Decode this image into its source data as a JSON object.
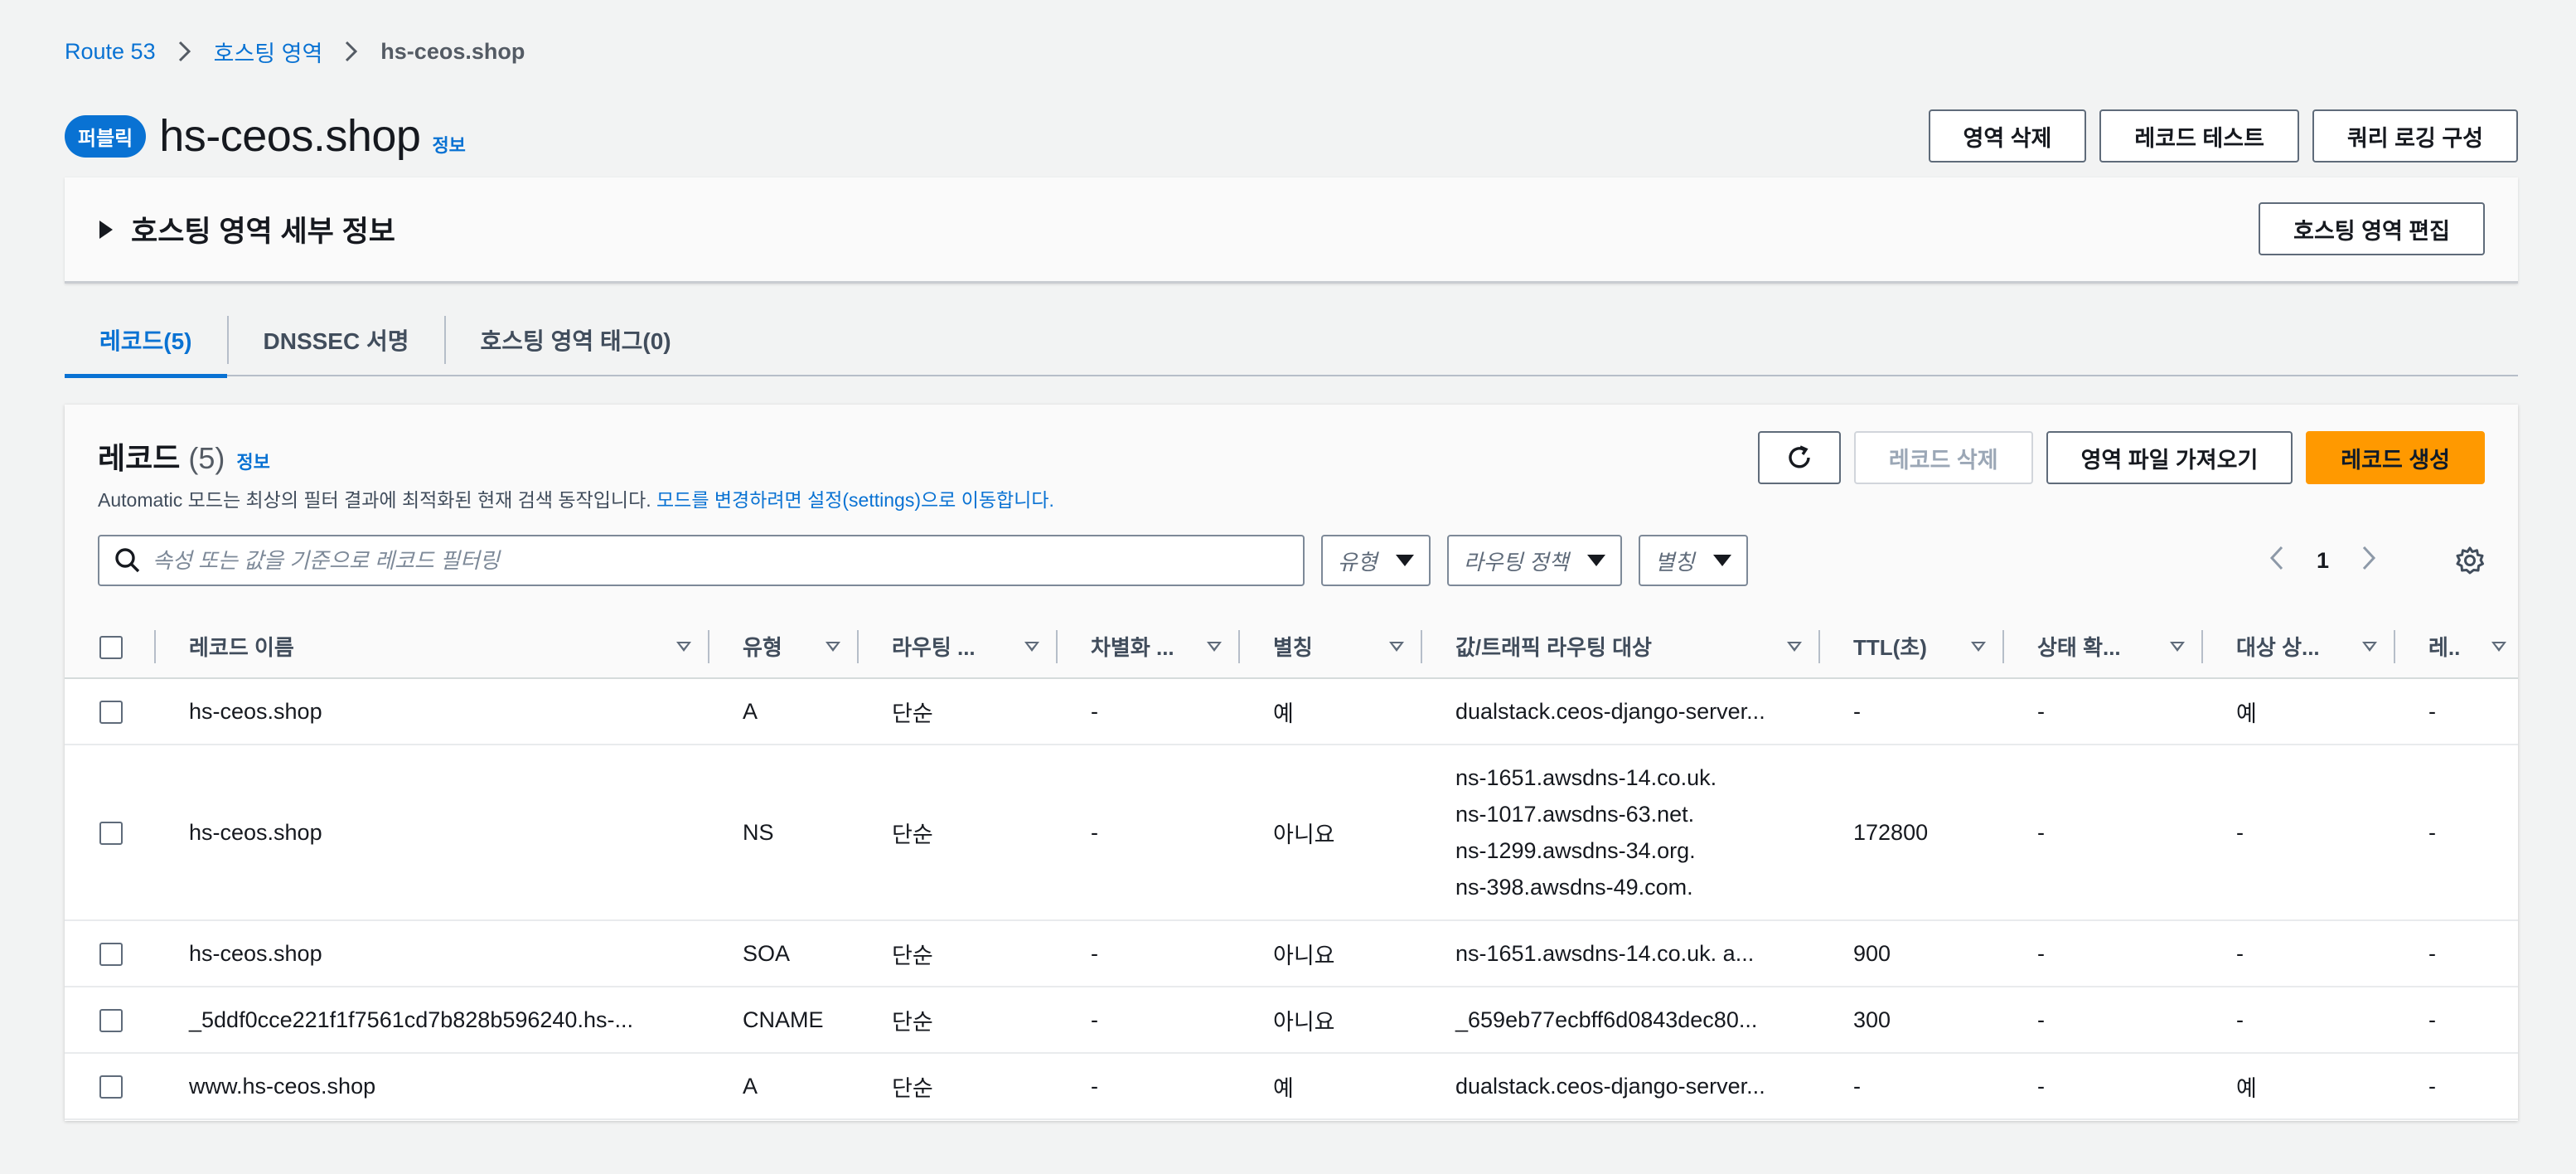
{
  "breadcrumb": {
    "root": "Route 53",
    "parent": "호스팅 영역",
    "current": "hs-ceos.shop"
  },
  "header": {
    "badge": "퍼블릭",
    "title": "hs-ceos.shop",
    "info": "정보",
    "actions": {
      "delete_zone": "영역 삭제",
      "test_record": "레코드 테스트",
      "query_logging": "쿼리 로깅 구성"
    }
  },
  "details": {
    "title": "호스팅 영역 세부 정보",
    "edit_button": "호스팅 영역 편집"
  },
  "tabs": [
    {
      "label": "레코드(5)"
    },
    {
      "label": "DNSSEC 서명"
    },
    {
      "label": "호스팅 영역 태그(0)"
    }
  ],
  "records": {
    "title": "레코드",
    "count": "(5)",
    "info": "정보",
    "desc_prefix": "Automatic 모드는 최상의 필터 결과에 최적화된 현재 검색 동작입니다. ",
    "desc_link": "모드를 변경하려면 설정(settings)으로 이동합니다.",
    "buttons": {
      "delete": "레코드 삭제",
      "import": "영역 파일 가져오기",
      "create": "레코드 생성"
    },
    "search_placeholder": "속성 또는 값을 기준으로 레코드 필터링",
    "filters": {
      "type": "유형",
      "routing": "라우팅 정책",
      "alias": "별칭"
    },
    "page": "1",
    "columns": [
      "레코드 이름",
      "유형",
      "라우팅 ...",
      "차별화 ...",
      "별칭",
      "값/트래픽 라우팅 대상",
      "TTL(초)",
      "상태 확...",
      "대상 상...",
      "레.."
    ],
    "rows": [
      {
        "name": "hs-ceos.shop",
        "type": "A",
        "routing": "단순",
        "diff": "-",
        "alias": "예",
        "value": "dualstack.ceos-django-server...",
        "ttl": "-",
        "health": "-",
        "target": "예",
        "last": "-"
      },
      {
        "name": "hs-ceos.shop",
        "type": "NS",
        "routing": "단순",
        "diff": "-",
        "alias": "아니요",
        "value_lines": [
          "ns-1651.awsdns-14.co.uk.",
          "ns-1017.awsdns-63.net.",
          "ns-1299.awsdns-34.org.",
          "ns-398.awsdns-49.com."
        ],
        "ttl": "172800",
        "health": "-",
        "target": "-",
        "last": "-"
      },
      {
        "name": "hs-ceos.shop",
        "type": "SOA",
        "routing": "단순",
        "diff": "-",
        "alias": "아니요",
        "value": "ns-1651.awsdns-14.co.uk. a...",
        "ttl": "900",
        "health": "-",
        "target": "-",
        "last": "-"
      },
      {
        "name": "_5ddf0cce221f1f7561cd7b828b596240.hs-...",
        "type": "CNAME",
        "routing": "단순",
        "diff": "-",
        "alias": "아니요",
        "value": "_659eb77ecbff6d0843dec80...",
        "ttl": "300",
        "health": "-",
        "target": "-",
        "last": "-"
      },
      {
        "name": "www.hs-ceos.shop",
        "type": "A",
        "routing": "단순",
        "diff": "-",
        "alias": "예",
        "value": "dualstack.ceos-django-server...",
        "ttl": "-",
        "health": "-",
        "target": "예",
        "last": "-"
      }
    ]
  },
  "colors": {
    "accent": "#0972d3",
    "primary_button": "#ff9900",
    "background": "#f2f3f3"
  }
}
